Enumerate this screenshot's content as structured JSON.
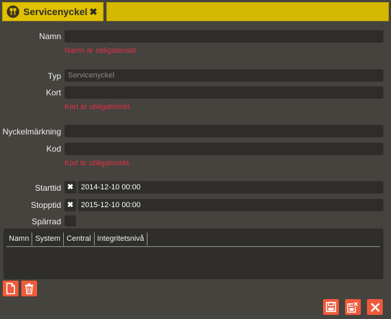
{
  "tab": {
    "title": "Servicenyckel",
    "close": "✖",
    "icon": "key-icon"
  },
  "form": {
    "namn": {
      "label": "Namn",
      "value": "",
      "error": "Namn är obligatoriskt."
    },
    "typ": {
      "label": "Typ",
      "value": "Servicenyckel"
    },
    "kort": {
      "label": "Kort",
      "value": "",
      "error": "Kort är obligatoriskt."
    },
    "nyckelmarkning": {
      "label": "Nyckelmärkning",
      "value": ""
    },
    "kod": {
      "label": "Kod",
      "value": "",
      "error": "Kod är obligatoriskt."
    },
    "starttid": {
      "label": "Starttid",
      "clear": "✖",
      "value": "2014-12-10 00:00"
    },
    "stopptid": {
      "label": "Stopptid",
      "clear": "✖",
      "value": "2015-12-10 00:00"
    },
    "sparrad": {
      "label": "Spärrad",
      "checked": false
    }
  },
  "table": {
    "columns": [
      "Namn",
      "System",
      "Central",
      "Integritetsnivå"
    ]
  },
  "colors": {
    "accent": "#e0c100",
    "danger": "#f05a3c",
    "error_text": "#e0304a",
    "background": "#45433d"
  }
}
